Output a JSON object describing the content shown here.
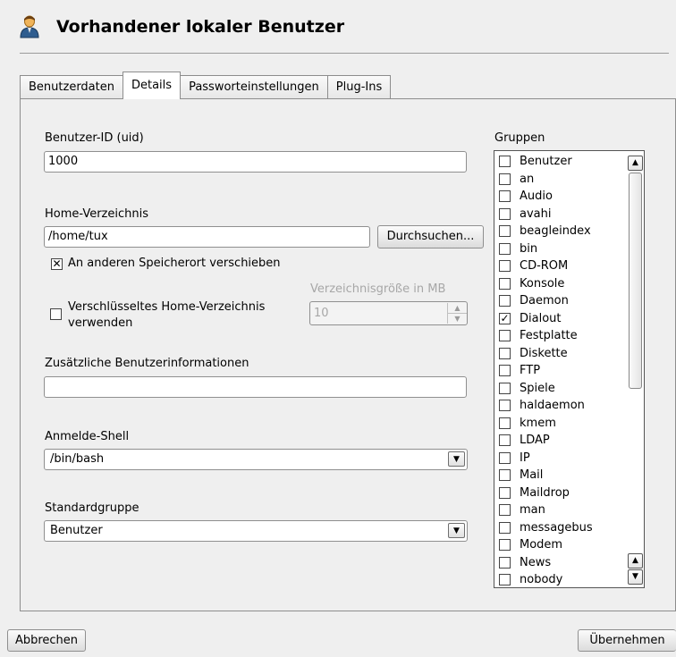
{
  "window": {
    "title": "Vorhandener lokaler Benutzer"
  },
  "tabs": [
    {
      "label": "Benutzerdaten",
      "active": false
    },
    {
      "label": "Details",
      "active": true
    },
    {
      "label": "Passworteinstellungen",
      "active": false
    },
    {
      "label": "Plug-Ins",
      "active": false
    }
  ],
  "details": {
    "uid_label": "Benutzer-ID (uid)",
    "uid_value": "1000",
    "home_label": "Home-Verzeichnis",
    "home_value": "/home/tux",
    "browse_label": "Durchsuchen...",
    "move_checkbox_label": "An anderen Speicherort verschieben",
    "move_checked": true,
    "encrypt_label_line1": "Verschlüsseltes Home-Verzeichnis",
    "encrypt_label_line2": "verwenden",
    "encrypt_checked": false,
    "dirsize_label": "Verzeichnisgröße in MB",
    "dirsize_value": "10",
    "extra_info_label": "Zusätzliche Benutzerinformationen",
    "extra_info_value": "",
    "shell_label": "Anmelde-Shell",
    "shell_value": "/bin/bash",
    "default_group_label": "Standardgruppe",
    "default_group_value": "Benutzer"
  },
  "groups": {
    "label": "Gruppen",
    "items": [
      {
        "name": "Benutzer",
        "checked": false
      },
      {
        "name": "an",
        "checked": false
      },
      {
        "name": "Audio",
        "checked": false
      },
      {
        "name": "avahi",
        "checked": false
      },
      {
        "name": "beagleindex",
        "checked": false
      },
      {
        "name": "bin",
        "checked": false
      },
      {
        "name": "CD-ROM",
        "checked": false
      },
      {
        "name": "Konsole",
        "checked": false
      },
      {
        "name": "Daemon",
        "checked": false
      },
      {
        "name": "Dialout",
        "checked": true
      },
      {
        "name": "Festplatte",
        "checked": false
      },
      {
        "name": "Diskette",
        "checked": false
      },
      {
        "name": "FTP",
        "checked": false
      },
      {
        "name": "Spiele",
        "checked": false
      },
      {
        "name": "haldaemon",
        "checked": false
      },
      {
        "name": "kmem",
        "checked": false
      },
      {
        "name": "LDAP",
        "checked": false
      },
      {
        "name": "IP",
        "checked": false
      },
      {
        "name": "Mail",
        "checked": false
      },
      {
        "name": "Maildrop",
        "checked": false
      },
      {
        "name": "man",
        "checked": false
      },
      {
        "name": "messagebus",
        "checked": false
      },
      {
        "name": "Modem",
        "checked": false
      },
      {
        "name": "News",
        "checked": false
      },
      {
        "name": "nobody",
        "checked": false
      }
    ]
  },
  "footer": {
    "cancel_label": "Abbrechen",
    "apply_label": "Übernehmen"
  },
  "icons": {
    "title_icon": "user-icon",
    "check_mark": "✕",
    "check_tick": "✓"
  },
  "colors": {
    "background": "#efefef",
    "field_bg": "#ffffff",
    "border": "#8f8f8f",
    "disabled_text": "#a7a7a7"
  }
}
